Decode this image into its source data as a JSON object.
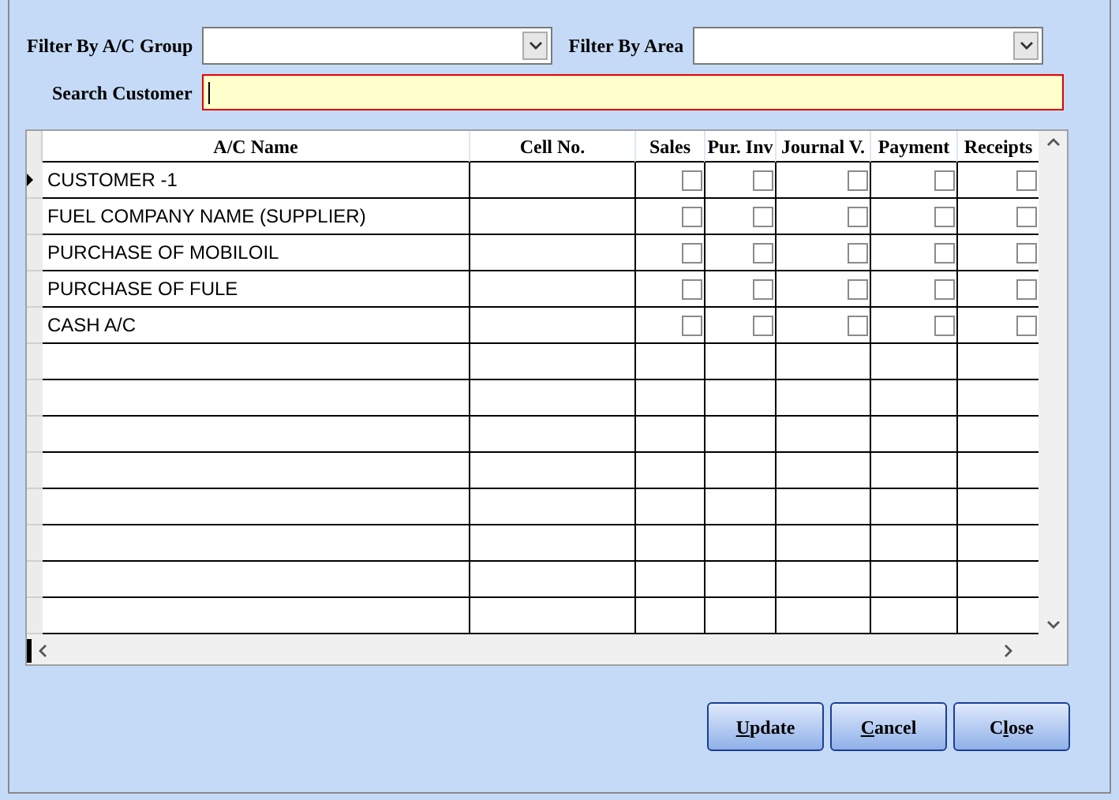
{
  "filters": [
    {
      "label": "Filter By A/C Group"
    },
    {
      "label": "Filter By Area"
    }
  ],
  "search": {
    "label": "Search Customer",
    "focused": true
  },
  "table": {
    "columns": [
      "A/C Name",
      "Cell No.",
      "Sales",
      "Pur. Inv",
      "Journal V.",
      "Payment",
      "Receipts"
    ],
    "rows": [
      {
        "name": "CUSTOMER -1",
        "current": true,
        "checks": [
          false,
          false,
          false,
          false,
          false
        ]
      },
      {
        "name": "FUEL COMPANY NAME (SUPPLIER)",
        "current": false,
        "checks": [
          false,
          false,
          false,
          false,
          false
        ]
      },
      {
        "name": "PURCHASE OF MOBILOIL",
        "current": false,
        "checks": [
          false,
          false,
          false,
          false,
          false
        ]
      },
      {
        "name": "PURCHASE OF FULE",
        "current": false,
        "checks": [
          false,
          false,
          false,
          false,
          false
        ]
      },
      {
        "name": "CASH A/C",
        "current": false,
        "checks": [
          false,
          false,
          false,
          false,
          false
        ]
      }
    ]
  },
  "buttons": [
    {
      "key": "U",
      "after": "pdate"
    },
    {
      "key": "C",
      "after": "ancel"
    },
    {
      "before": "C",
      "key": "l",
      "after": "ose"
    }
  ]
}
